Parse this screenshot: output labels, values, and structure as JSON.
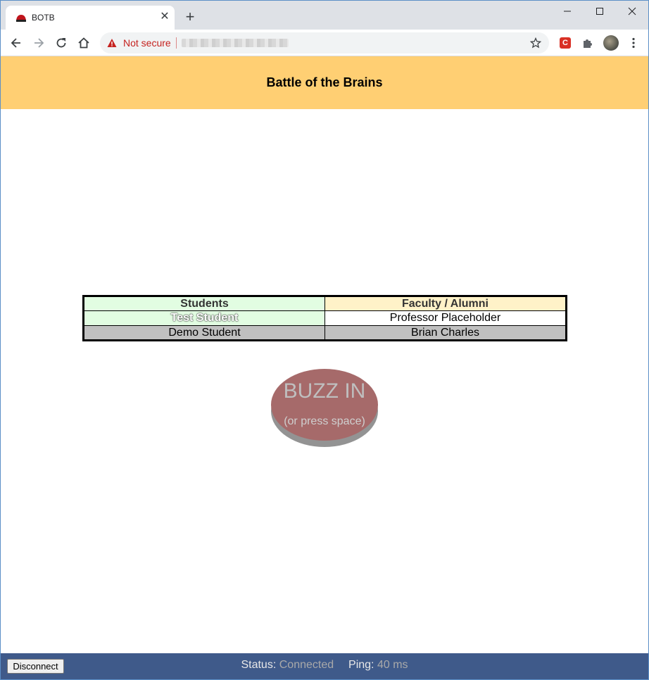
{
  "browser": {
    "tab_title": "BOTB",
    "security_label": "Not secure",
    "icons": [
      "back-icon",
      "forward-icon",
      "reload-icon",
      "home-icon",
      "warning-icon",
      "star-icon",
      "extensions-icon",
      "more-icon"
    ],
    "extension_badge": "C"
  },
  "header": {
    "title": "Battle of the Brains",
    "background": "#ffcf73"
  },
  "scoreboard": {
    "columns": [
      "Students",
      "Faculty / Alumni"
    ],
    "rows": [
      [
        "Test Student",
        "Professor Placeholder"
      ],
      [
        "Demo Student",
        "Brian Charles"
      ]
    ]
  },
  "buzzer": {
    "label": "BUZZ IN",
    "hint": "(or press space)"
  },
  "footer": {
    "disconnect_label": "Disconnect",
    "status_label": "Status:",
    "status_value": "Connected",
    "ping_label": "Ping:",
    "ping_value": "40 ms",
    "background": "#3f5a8a"
  }
}
